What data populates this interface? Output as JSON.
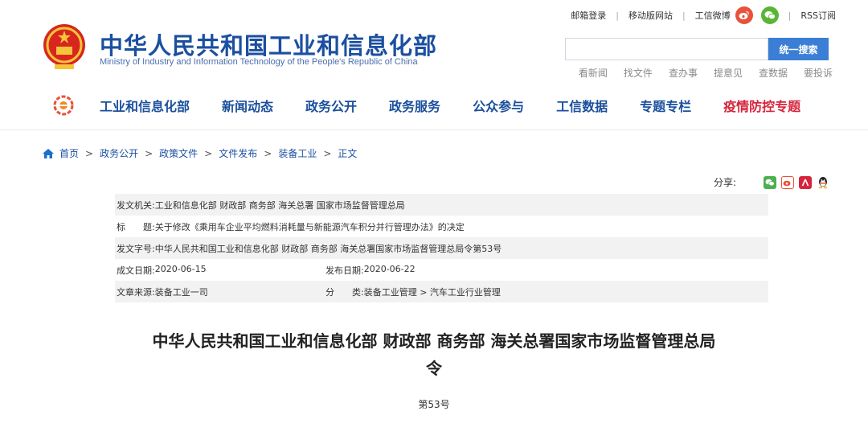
{
  "header": {
    "title": "中华人民共和国工业和信息化部",
    "subtitle": "Ministry of Industry and Information Technology of the People's Republic of China",
    "toplinks": {
      "mail": "邮箱登录",
      "mobile": "移动版网站",
      "weibo": "工信微博",
      "rss": "RSS订阅"
    },
    "search": {
      "placeholder": "",
      "button": "统一搜索"
    },
    "quicklinks": [
      "看新闻",
      "找文件",
      "查办事",
      "提意见",
      "查数据",
      "要投诉"
    ]
  },
  "nav": {
    "items": [
      "工业和信息化部",
      "新闻动态",
      "政务公开",
      "政务服务",
      "公众参与",
      "工信数据",
      "专题专栏",
      "疫情防控专题"
    ]
  },
  "breadcrumb": [
    "首页",
    "政务公开",
    "政策文件",
    "文件发布",
    "装备工业",
    "正文"
  ],
  "share": {
    "label": "分享:"
  },
  "info": {
    "issuer_label": "发文机关:",
    "issuer": "工业和信息化部 财政部 商务部 海关总署 国家市场监督管理总局",
    "title_label": "标　　题:",
    "title": "关于修改《乘用车企业平均燃料消耗量与新能源汽车积分并行管理办法》的决定",
    "docno_label": "发文字号:",
    "docno": "中华人民共和国工业和信息化部 财政部 商务部 海关总署国家市场监督管理总局令第53号",
    "created_label": "成文日期:",
    "created": "2020-06-15",
    "published_label": "发布日期:",
    "published": "2020-06-22",
    "source_label": "文章来源:",
    "source": "装备工业一司",
    "category_label": "分　　类:",
    "category": "装备工业管理 > 汽车工业行业管理"
  },
  "document": {
    "title_line1": "中华人民共和国工业和信息化部 财政部 商务部 海关总署国家市场监督管理总局",
    "title_line2": "令",
    "number": "第53号"
  },
  "colors": {
    "brand_blue": "#1b4fa0",
    "search_button": "#3a7fd5",
    "nav_red": "#d6243a",
    "weibo": "#e8513a",
    "wechat": "#5ab534"
  }
}
